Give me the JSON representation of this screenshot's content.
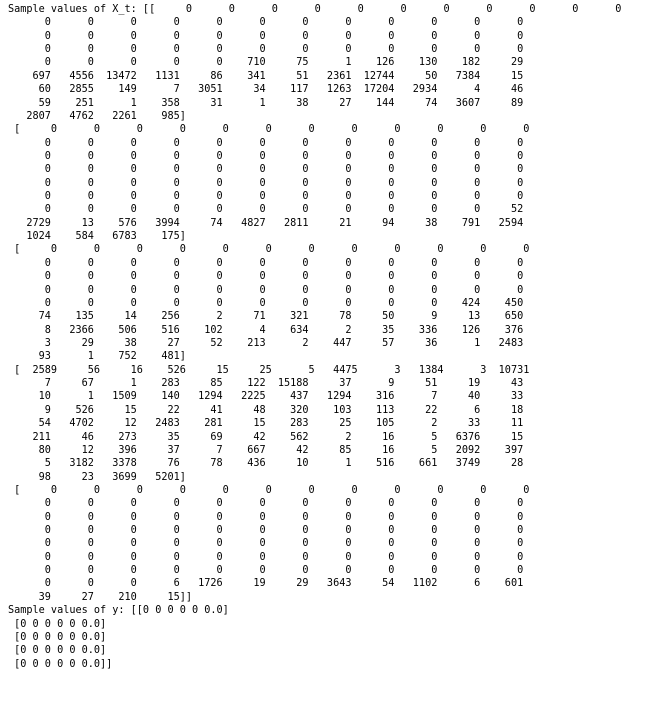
{
  "output": {
    "lines": [
      "Sample values of X_t: [[     0      0      0      0      0      0      0      0      0      0      0      0",
      "      0      0      0      0      0      0      0      0      0      0      0      0",
      "      0      0      0      0      0      0      0      0      0      0      0      0",
      "      0      0      0      0      0      0      0      0      0      0      0      0",
      "      0      0      0      0      0    710     75      1    126    130    182     29",
      "    697   4556  13472   1131     86    341     51   2361  12744     50   7384     15",
      "     60   2855    149      7   3051     34    117   1263  17204   2934      4     46",
      "     59    251      1    358     31      1     38     27    144     74   3607     89",
      "   2807   4762   2261    985]",
      " [     0      0      0      0      0      0      0      0      0      0      0      0",
      "      0      0      0      0      0      0      0      0      0      0      0      0",
      "      0      0      0      0      0      0      0      0      0      0      0      0",
      "      0      0      0      0      0      0      0      0      0      0      0      0",
      "      0      0      0      0      0      0      0      0      0      0      0      0",
      "      0      0      0      0      0      0      0      0      0      0      0      0",
      "      0      0      0      0      0      0      0      0      0      0      0     52",
      "   2729     13    576   3994     74   4827   2811     21     94     38    791   2594",
      "   1024    584   6783    175]",
      " [     0      0      0      0      0      0      0      0      0      0      0      0",
      "      0      0      0      0      0      0      0      0      0      0      0      0",
      "      0      0      0      0      0      0      0      0      0      0      0      0",
      "      0      0      0      0      0      0      0      0      0      0      0      0",
      "      0      0      0      0      0      0      0      0      0      0    424    450",
      "     74    135     14    256      2     71    321     78     50      9     13    650",
      "      8   2366    506    516    102      4    634      2     35    336    126    376",
      "      3     29     38     27     52    213      2    447     57     36      1   2483",
      "     93      1    752    481]",
      " [  2589     56     16    526     15     25      5   4475      3   1384      3  10731",
      "      7     67      1    283     85    122  15188     37      9     51     19     43",
      "     10      1   1509    140   1294   2225    437   1294    316      7     40     33",
      "      9    526     15     22     41     48    320    103    113     22      6     18",
      "     54   4702     12   2483    281     15    283     25    105      2     33     11",
      "    211     46    273     35     69     42    562      2     16      5   6376     15",
      "     80     12    396     37      7    667     42     85     16      5   2092    397",
      "      5   3182   3378     76     78    436     10      1    516    661   3749     28",
      "     98     23   3699   5201]",
      " [     0      0      0      0      0      0      0      0      0      0      0      0",
      "      0      0      0      0      0      0      0      0      0      0      0      0",
      "      0      0      0      0      0      0      0      0      0      0      0      0",
      "      0      0      0      0      0      0      0      0      0      0      0      0",
      "      0      0      0      0      0      0      0      0      0      0      0      0",
      "      0      0      0      0      0      0      0      0      0      0      0      0",
      "      0      0      0      0      0      0      0      0      0      0      0      0",
      "      0      0      0      6   1726     19     29   3643     54   1102      6    601",
      "     39     27    210     15]]",
      "Sample values of y: [[0 0 0 0 0 0.0]",
      " [0 0 0 0 0 0.0]",
      " [0 0 0 0 0 0.0]",
      " [0 0 0 0 0 0.0]",
      " [0 0 0 0 0 0.0]]"
    ]
  }
}
